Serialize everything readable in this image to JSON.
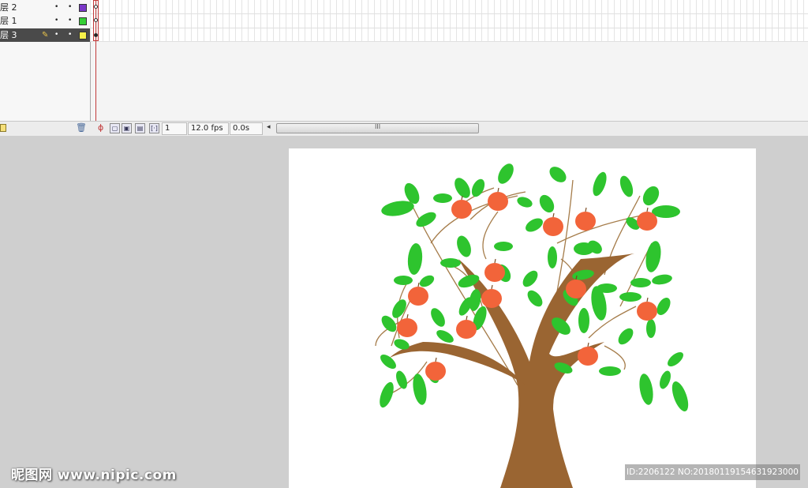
{
  "timeline": {
    "layers": [
      {
        "name": "层 2",
        "color": "#7a37c8",
        "selected": false
      },
      {
        "name": "层 1",
        "color": "#35cf35",
        "selected": false
      },
      {
        "name": "层 3",
        "color": "#f6f04a",
        "selected": true
      }
    ],
    "frame_number": "1",
    "fps": "12.0 fps",
    "time": "0.0s"
  },
  "stage": {
    "background": "#ffffff",
    "leaf_color": "#2ec42e",
    "apple_color": "#f2643a",
    "trunk_color": "#9a6532",
    "branch_color": "#a57c4a"
  },
  "watermark": {
    "left": "昵图网 www.nipic.com",
    "right": "ID:2206122 NO:20180119154631923000"
  }
}
